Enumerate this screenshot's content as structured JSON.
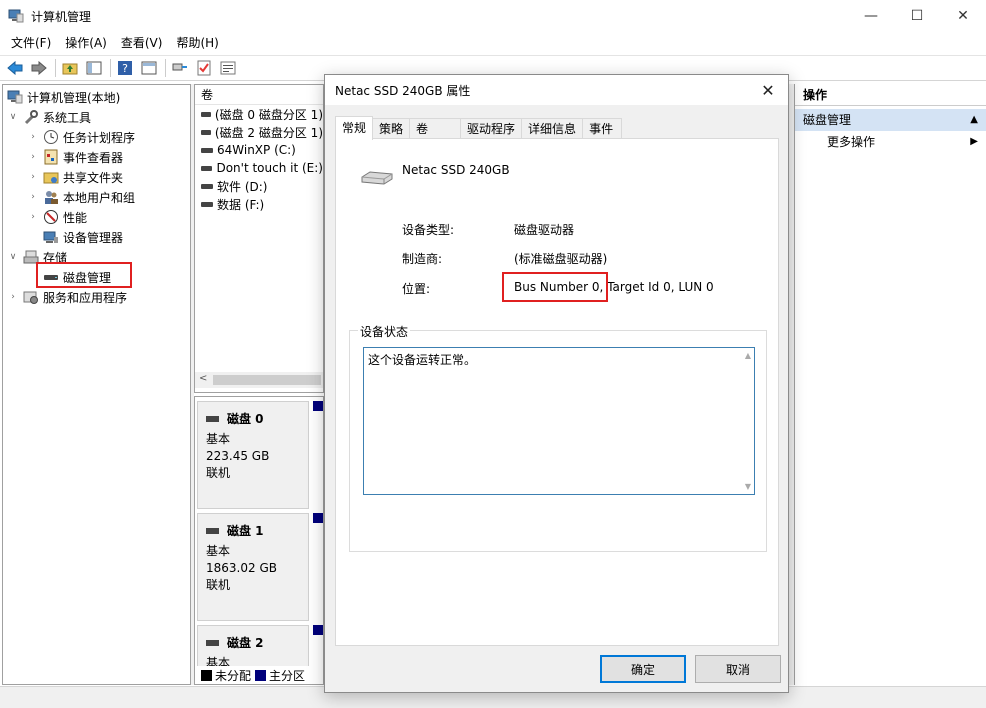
{
  "window": {
    "title": "计算机管理",
    "controls": {
      "minimize": "—",
      "maximize": "☐",
      "close": "✕"
    }
  },
  "menu": [
    "文件(F)",
    "操作(A)",
    "查看(V)",
    "帮助(H)"
  ],
  "tree": {
    "root": "计算机管理(本地)",
    "system_tools": "系统工具",
    "task_scheduler": "任务计划程序",
    "event_viewer": "事件查看器",
    "shared_folders": "共享文件夹",
    "local_users": "本地用户和组",
    "performance": "性能",
    "device_manager": "设备管理器",
    "storage": "存储",
    "disk_management": "磁盘管理",
    "services_apps": "服务和应用程序"
  },
  "volumes": {
    "header": "卷",
    "items": [
      "(磁盘 0 磁盘分区 1)",
      "(磁盘 2 磁盘分区 1)",
      "64WinXP (C:)",
      "Don't touch it (E:)",
      "软件 (D:)",
      "数据 (F:)"
    ]
  },
  "disks": [
    {
      "name": "磁盘 0",
      "type": "基本",
      "size": "223.45 GB",
      "status": "联机"
    },
    {
      "name": "磁盘 1",
      "type": "基本",
      "size": "1863.02 GB",
      "status": "联机"
    },
    {
      "name": "磁盘 2",
      "type": "基本",
      "size": "",
      "status": ""
    }
  ],
  "legend": {
    "unallocated": "未分配",
    "primary": "主分区",
    "unallocated_color": "#000000",
    "primary_color": "#00007b"
  },
  "actions": {
    "header": "操作",
    "section": "磁盘管理",
    "more": "更多操作"
  },
  "dialog": {
    "title": "Netac SSD 240GB 属性",
    "tabs": [
      "常规",
      "策略",
      "卷",
      "驱动程序",
      "详细信息",
      "事件"
    ],
    "device_name": "Netac SSD 240GB",
    "device_type_label": "设备类型:",
    "device_type_value": "磁盘驱动器",
    "manufacturer_label": "制造商:",
    "manufacturer_value": "(标准磁盘驱动器)",
    "location_label": "位置:",
    "location_value": "Bus Number 0, Target Id 0, LUN 0",
    "status_group": "设备状态",
    "status_text": "这个设备运转正常。",
    "ok": "确定",
    "cancel": "取消"
  },
  "colors": {
    "accent": "#0078d7",
    "highlight_red": "#e02020",
    "selection_blue": "#d4e3f4"
  }
}
